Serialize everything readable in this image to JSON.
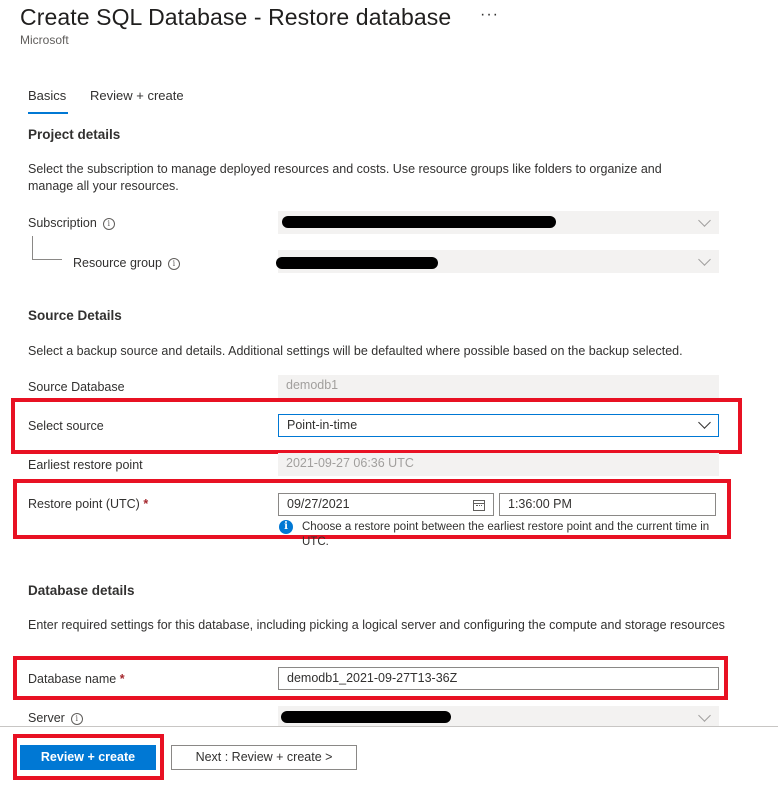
{
  "header": {
    "title": "Create SQL Database - Restore database",
    "more": "···",
    "publisher": "Microsoft"
  },
  "tabs": [
    {
      "label": "Basics",
      "active": true
    },
    {
      "label": "Review + create",
      "active": false
    }
  ],
  "project_details": {
    "title": "Project details",
    "description": "Select the subscription to manage deployed resources and costs. Use resource groups like folders to organize and manage all your resources.",
    "subscription_label": "Subscription",
    "resource_group_label": "Resource group"
  },
  "source_details": {
    "title": "Source Details",
    "description": "Select a backup source and details. Additional settings will be defaulted where possible based on the backup selected.",
    "source_database_label": "Source Database",
    "source_database_value": "demodb1",
    "select_source_label": "Select source",
    "select_source_value": "Point-in-time",
    "earliest_label": "Earliest restore point",
    "earliest_value": "2021-09-27 06:36 UTC",
    "restore_point_label": "Restore point (UTC)",
    "required_mark": "*",
    "restore_date": "09/27/2021",
    "restore_time": "1:36:00 PM",
    "restore_hint": "Choose a restore point between the earliest restore point and the current time in UTC."
  },
  "database_details": {
    "title": "Database details",
    "description": "Enter required settings for this database, including picking a logical server and configuring the compute and storage resources",
    "database_name_label": "Database name",
    "required_mark": "*",
    "database_name_value": "demodb1_2021-09-27T13-36Z",
    "server_label": "Server"
  },
  "footer": {
    "review_create_label": "Review + create",
    "next_label": "Next : Review + create >"
  },
  "colors": {
    "accent": "#0078d4",
    "highlight": "#e81123",
    "required": "#a4262c"
  }
}
